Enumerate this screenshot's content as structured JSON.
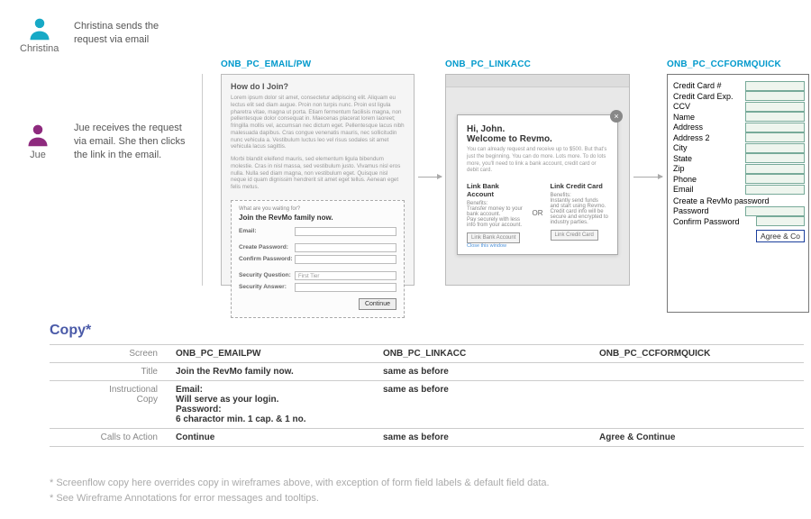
{
  "personas": {
    "christina": {
      "name": "Christina",
      "desc": "Christina sends the request via email"
    },
    "jue": {
      "name": "Jue",
      "desc": "Jue receives the request via email. She then clicks the link in the email."
    }
  },
  "labels": {
    "wf1": "ONB_PC_EMAIL/PW",
    "wf2": "ONB_PC_LINKACC",
    "wf3": "ONB_PC_CCFORMQUICK"
  },
  "wf1": {
    "header": "How do I Join?",
    "lorem1": "Lorem ipsum dolor sit amet, consectetur adipiscing elit. Aliquam eu lectus elit sed diam augue. Proin non turpis nunc. Proin est ligula pharetra vitae, magna ut porta. Etiam fermentum facilisis magna, non pellentesque dolor consequat in. Maecenas placerat lorem laoreet; fringilla mollis vel, accumsan nec dictum eget. Pellentesque lacus nibh malesuada dapibus. Cras congue venenatis mauris, nec sollicitudin nunc vehicula a. Vestibulum luctus leo vel risus sodales sit amet vehicula lacus sagittis.",
    "lorem2": "Morbi blandit eleifend mauris, sed elementum ligula bibendum molestie. Cras in nisl massa, sed vestibulum justo. Vivamus nisl eros nulla. Nulla sed diam magna, non vestibulum eget. Quisque nisl neque id quam dignissim hendrerit sit amet eget tellus. Aenean eget felis metus.",
    "prompt": "What are you waiting for?",
    "title": "Join the RevMo family now.",
    "fields": {
      "email": "Email:",
      "create": "Create Password:",
      "confirm": "Confirm Password:",
      "secq": "Security Question:",
      "seca": "Security Answer:",
      "secq_val": "First Tier"
    },
    "continue": "Continue"
  },
  "wf2": {
    "h1a": "Hi, John.",
    "h1b": "Welcome to Revmo.",
    "sub": "You can already request and receive up to $500. But that's just the beginning. You can do more. Lots more. To do lots more, you'll need to link a bank account, credit card or debit card.",
    "colA": {
      "h": "Link Bank Account",
      "sub": "Benefits:",
      "b1": "Transfer money to your bank account.",
      "b2": "Pay securely with less info from your account.",
      "btn": "Link Bank Account"
    },
    "or": "OR",
    "colB": {
      "h": "Link Credit Card",
      "sub": "Benefits:",
      "b1": "Instantly send funds and start using Revmo.",
      "b2": "Credit card info will be secure and encrypted to industry parties.",
      "btn": "Link Credit Card"
    },
    "footer": "Close this window"
  },
  "wf3": {
    "fields": [
      "Credit Card #",
      "Credit Card Exp.",
      "CCV",
      "Name",
      "Address",
      "Address 2",
      "City",
      "State",
      "Zip",
      "Phone",
      "Email"
    ],
    "pwheader": "Create a RevMo password",
    "pw1": "Password",
    "pw2": "Confirm Password",
    "btn": "Agree & Co"
  },
  "copy": {
    "title": "Copy*",
    "rows": {
      "screen": {
        "label": "Screen",
        "c1": "ONB_PC_EMAILPW",
        "c2": "ONB_PC_LINKACC",
        "c3": "ONB_PC_CCFORMQUICK"
      },
      "title": {
        "label": "Title",
        "c1": "Join the RevMo family now.",
        "c2": "same as before",
        "c3": ""
      },
      "instr": {
        "label": "Instructional Copy",
        "c1": "Email:\nWill serve as your login.\nPassword:\n6 charactor min. 1 cap. & 1 no.",
        "c2": "same as before",
        "c3": ""
      },
      "cta": {
        "label": "Calls to Action",
        "c1": "Continue",
        "c2": "same as before",
        "c3": "Agree & Continue"
      }
    }
  },
  "footnotes": {
    "l1": "* Screenflow copy here overrides copy in wireframes above, with exception of form field labels & default field data.",
    "l2": "* See Wireframe Annotations for error messages and tooltips."
  }
}
